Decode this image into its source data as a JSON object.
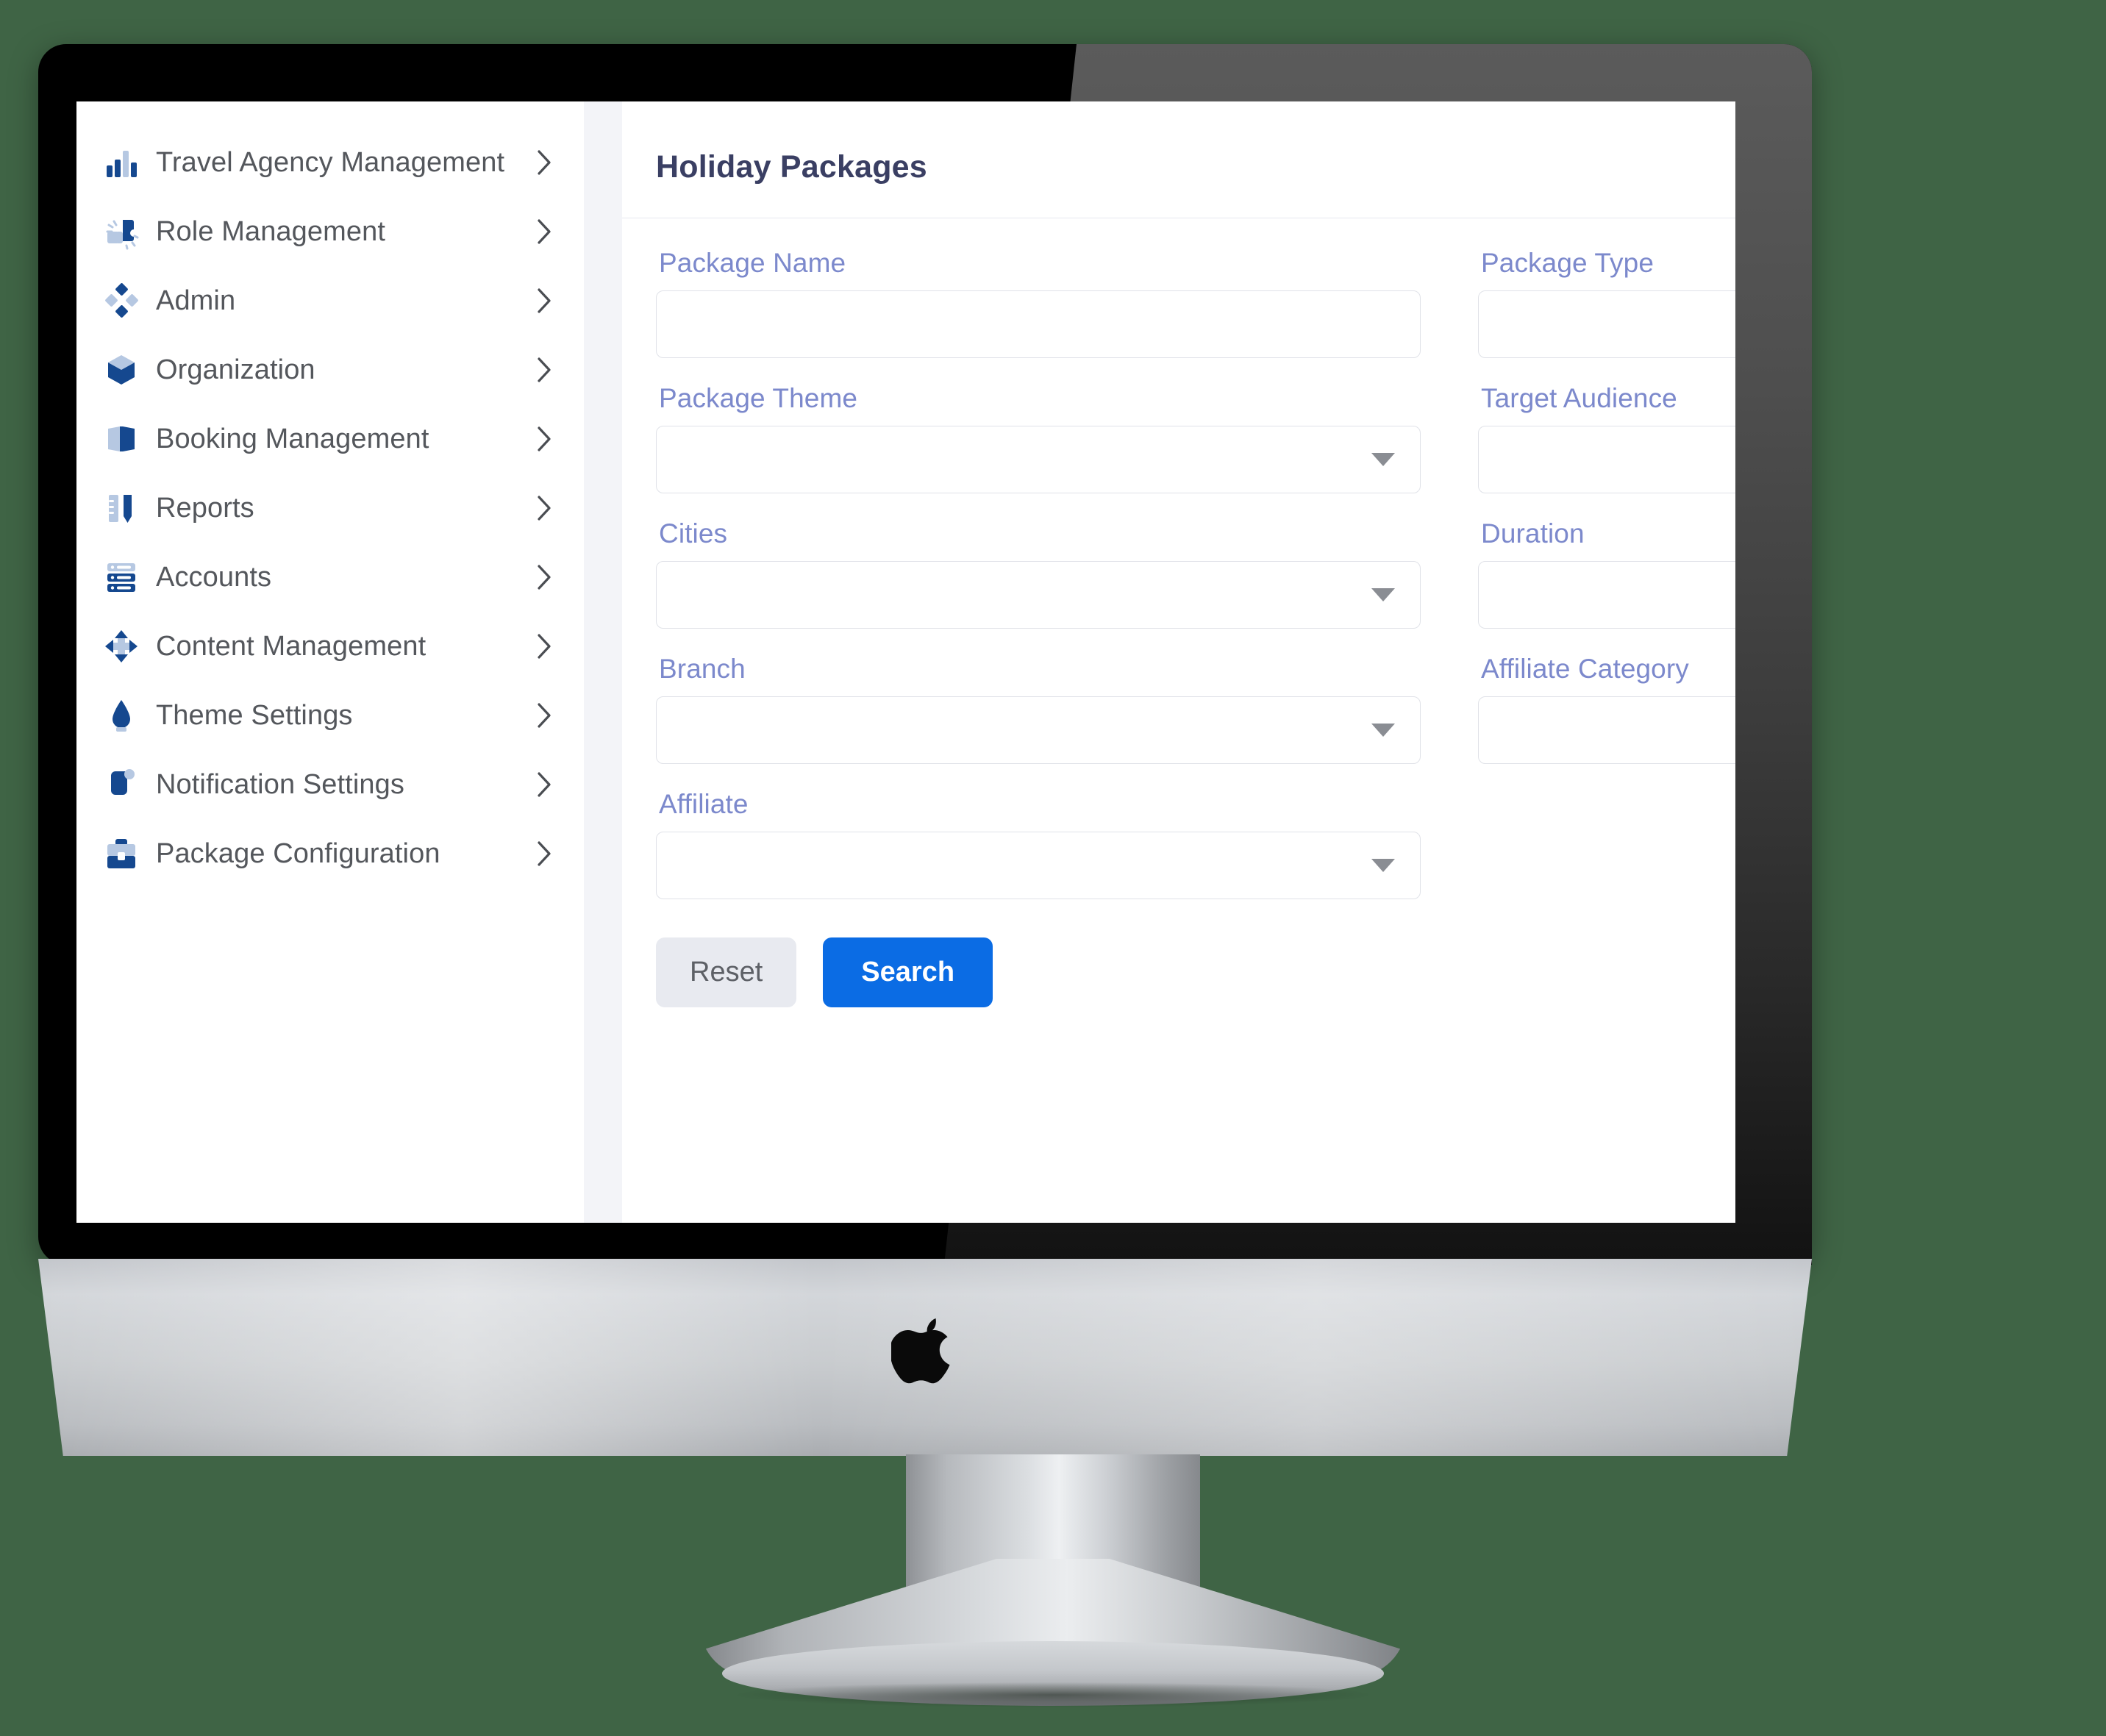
{
  "sidebar": {
    "items": [
      {
        "label": "Travel Agency Management",
        "icon": "bar-chart-icon"
      },
      {
        "label": "Role Management",
        "icon": "puzzle-piece-icon"
      },
      {
        "label": "Admin",
        "icon": "diamonds-icon"
      },
      {
        "label": "Organization",
        "icon": "cube-icon"
      },
      {
        "label": "Booking Management",
        "icon": "open-book-icon"
      },
      {
        "label": "Reports",
        "icon": "ruler-icon"
      },
      {
        "label": "Accounts",
        "icon": "server-rack-icon"
      },
      {
        "label": "Content Management",
        "icon": "move-arrows-icon"
      },
      {
        "label": "Theme Settings",
        "icon": "ink-drop-icon"
      },
      {
        "label": "Notification Settings",
        "icon": "bell-badge-icon"
      },
      {
        "label": "Package Configuration",
        "icon": "briefcase-icon"
      }
    ]
  },
  "main": {
    "title": "Holiday Packages",
    "fields": [
      {
        "label": "Package Name",
        "type": "text",
        "value": ""
      },
      {
        "label": "Package Type",
        "type": "text",
        "value": ""
      },
      {
        "label": "Package Theme",
        "type": "select",
        "value": ""
      },
      {
        "label": "Target Audience",
        "type": "text",
        "value": ""
      },
      {
        "label": "Cities",
        "type": "select",
        "value": ""
      },
      {
        "label": "Duration",
        "type": "text",
        "value": ""
      },
      {
        "label": "Branch",
        "type": "select",
        "value": ""
      },
      {
        "label": "Affiliate Category",
        "type": "text",
        "value": ""
      },
      {
        "label": "Affiliate",
        "type": "select",
        "value": ""
      }
    ],
    "buttons": {
      "reset": "Reset",
      "search": "Search"
    }
  },
  "colors": {
    "background": "#3f6445",
    "primary_button": "#0b6ce4",
    "label": "#7c89cc",
    "title": "#3a3f63",
    "icon_dark": "#15488f",
    "icon_light": "#b6c8e2"
  }
}
